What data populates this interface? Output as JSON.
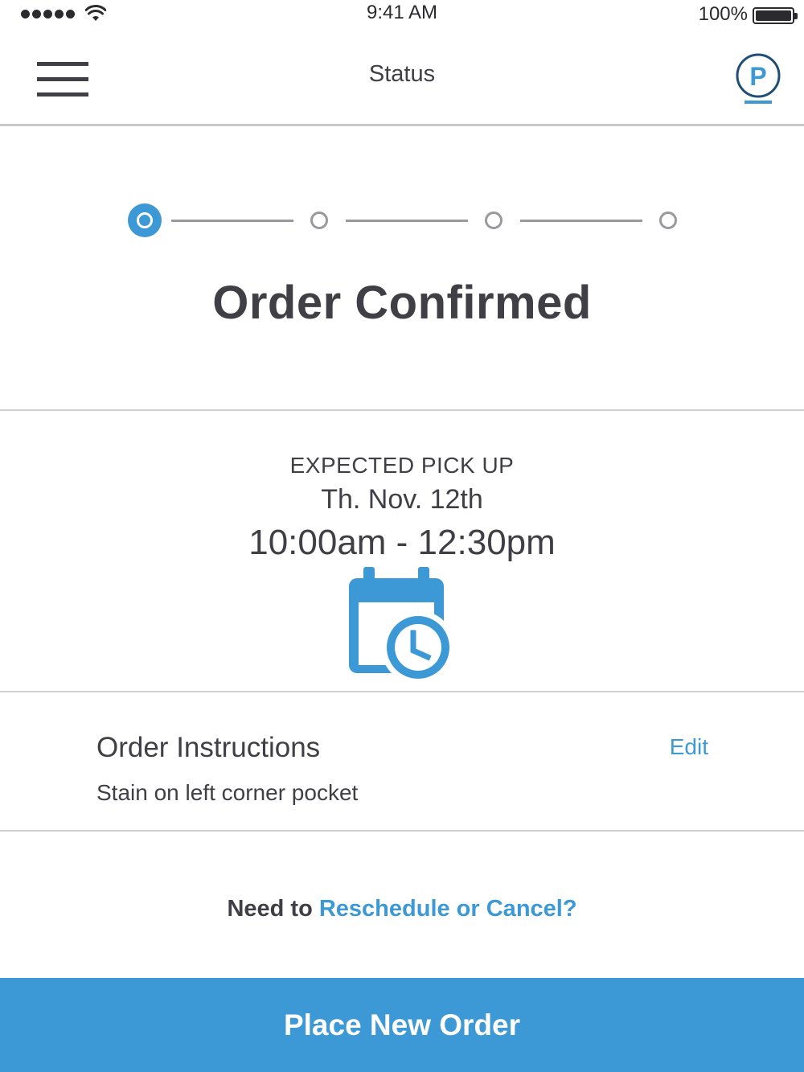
{
  "status_bar": {
    "time": "9:41 AM",
    "battery_percent": "100%",
    "signal_bars": 5,
    "wifi_icon": "wifi-icon",
    "battery_level": 1.0
  },
  "navbar": {
    "title": "Status",
    "menu_icon": "hamburger-menu-icon",
    "profile_icon": "parking-p-icon",
    "profile_letter": "P"
  },
  "progress": {
    "total_steps": 4,
    "current_step": 1,
    "active_color": "#3d99d5",
    "inactive_color": "#9a9a9e"
  },
  "headline": "Order Confirmed",
  "pickup": {
    "label": "EXPECTED PICK UP",
    "date": "Th. Nov. 12th",
    "time_range": "10:00am - 12:30pm",
    "icon": "calendar-clock-icon"
  },
  "instructions": {
    "title": "Order Instructions",
    "edit_label": "Edit",
    "text": "Stain on left corner pocket"
  },
  "reschedule": {
    "prefix": "Need to",
    "link": "Reschedule or Cancel?"
  },
  "place_order_label": "Place New Order",
  "colors": {
    "accent": "#3d99d5",
    "text": "#3f3f45",
    "profile_ring": "#1f4e79"
  }
}
